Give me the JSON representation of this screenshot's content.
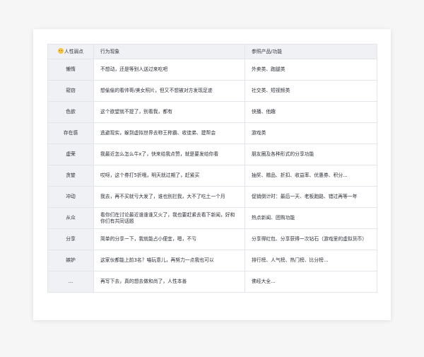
{
  "table": {
    "headers": [
      "人性弱点",
      "行为现象",
      "参照产品/功能"
    ],
    "rows": [
      [
        "懒惰",
        "不想动，还是等别人送过来吃吧",
        "外卖类、跑腿类"
      ],
      [
        "窥窃",
        "想偷偷的看帅哥/美女照片，但又不想被对方发现足迹",
        "社交类、短视频类"
      ],
      [
        "色欲",
        "这个欲望就不提了，别看我，都有",
        "快播、他趣"
      ],
      [
        "存在感",
        "逃避现实，躲到虚拟世界去称王称霸、收徒弟、建帮会",
        "游戏类"
      ],
      [
        "虚荣",
        "我最近怎么怎么牛x了，快来给我点赞，就是要发给你看",
        "朋友圈及各种形式的分享功能"
      ],
      [
        "贪婪",
        "哎呀，这个券打5折哦，明天就过期了，赶紧买",
        "抽奖、赠品、折扣、收益率、优惠券、积分..."
      ],
      [
        "冲动",
        "我去，再不买就亏大发了，谁也别拦我，大不了吃土一个月",
        "促销倒计时：最后一天、老板跑路、错过再等一年"
      ],
      [
        "从众",
        "看你们在讨论最近谁谁谁又火了，我也要赶紧去看下新闻，好和你们有共同话题",
        "热点新闻、团购功能"
      ],
      [
        "分享",
        "简单的分享一下，我就能占小便宜，嗯，不亏",
        "分享得红包、分享获得一次钻石（游戏里的虚拟货币）"
      ],
      [
        "嫉妒",
        "这家伙都能上前3名？喵玩意儿，再努力一点我也可以",
        "排行榜、人气榜、热门榜、比分榜..."
      ],
      [
        "...",
        "再写下去，真的想去做和尚了，人性本善",
        "佛经大全..."
      ]
    ]
  },
  "icons": {
    "header_emoji": "smiling-face-icon"
  },
  "colors": {
    "page_background": "#f6f6f7",
    "header_background": "#f0f1f5",
    "border": "#e3e5ea"
  }
}
